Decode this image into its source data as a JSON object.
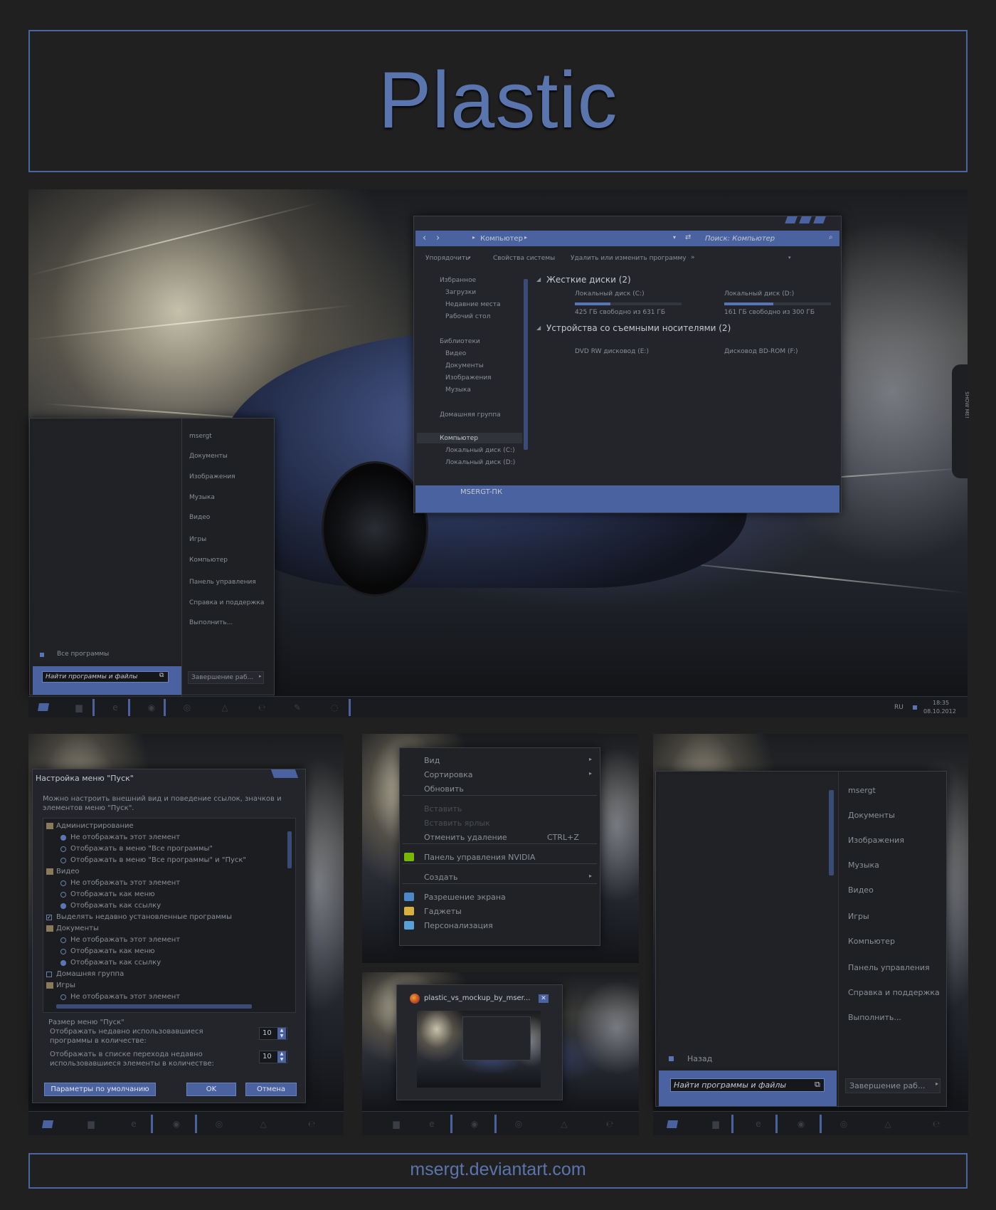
{
  "header": {
    "title": "Plastic"
  },
  "footer": {
    "url": "msergt.deviantart.com"
  },
  "explorer": {
    "breadcrumb": "Компьютер",
    "search_placeholder": "Поиск: Компьютер",
    "toolbar": [
      "Упорядочить",
      "Свойства системы",
      "Удалить или изменить программу",
      "»"
    ],
    "nav": {
      "favorites": "Избранное",
      "fav_items": [
        "Загрузки",
        "Недавние места",
        "Рабочий стол"
      ],
      "libraries": "Библиотеки",
      "lib_items": [
        "Видео",
        "Документы",
        "Изображения",
        "Музыка"
      ],
      "homegroup": "Домашняя группа",
      "computer": "Компьютер",
      "comp_items": [
        "Локальный диск (C:)",
        "Локальный диск (D:)"
      ]
    },
    "hdd_group": "Жесткие диски (2)",
    "drives": [
      {
        "name": "Локальный диск (C:)",
        "free": "425 ГБ свободно из 631 ГБ",
        "used_fraction": 0.33
      },
      {
        "name": "Локальный диск (D:)",
        "free": "161 ГБ свободно из 300 ГБ",
        "used_fraction": 0.46
      }
    ],
    "removable_group": "Устройства со съемными носителями (2)",
    "removable": [
      "DVD RW дисковод (E:)",
      "Дисковод BD-ROM (F:)"
    ],
    "status_name": "MSERGT-ПК"
  },
  "side_tab": "SHOW ME!",
  "start_menu": {
    "items": [
      "msergt",
      "Документы",
      "Изображения",
      "Музыка",
      "Видео",
      "Игры",
      "Компьютер",
      "Панель управления",
      "Справка и поддержка",
      "Выполнить..."
    ],
    "all_programs": "Все программы",
    "search_placeholder": "Найти программы и файлы",
    "shutdown": "Завершение раб..."
  },
  "tray": {
    "lang": "RU",
    "time": "18:35",
    "date": "08.10.2012"
  },
  "customize_dialog": {
    "title": "Настройка меню \"Пуск\"",
    "description_1": "Можно настроить внешний вид и поведение ссылок, значков и",
    "description_2": "элементов меню \"Пуск\".",
    "tree": [
      {
        "type": "folder",
        "label": "Администрирование"
      },
      {
        "type": "radio",
        "on": true,
        "label": "Не отображать этот элемент"
      },
      {
        "type": "radio",
        "on": false,
        "label": "Отображать в меню \"Все программы\""
      },
      {
        "type": "radio",
        "on": false,
        "label": "Отображать в меню \"Все программы\" и \"Пуск\""
      },
      {
        "type": "folder",
        "label": "Видео"
      },
      {
        "type": "radio",
        "on": false,
        "label": "Не отображать этот элемент"
      },
      {
        "type": "radio",
        "on": false,
        "label": "Отображать как меню"
      },
      {
        "type": "radio",
        "on": true,
        "label": "Отображать как ссылку"
      },
      {
        "type": "check",
        "on": true,
        "label": "Выделять недавно установленные программы"
      },
      {
        "type": "folder",
        "label": "Документы"
      },
      {
        "type": "radio",
        "on": false,
        "label": "Не отображать этот элемент"
      },
      {
        "type": "radio",
        "on": false,
        "label": "Отображать как меню"
      },
      {
        "type": "radio",
        "on": true,
        "label": "Отображать как ссылку"
      },
      {
        "type": "check",
        "on": false,
        "label": "Домашняя группа"
      },
      {
        "type": "folder",
        "label": "Игры"
      },
      {
        "type": "radio",
        "on": false,
        "label": "Не отображать этот элемент"
      }
    ],
    "size_label": "Размер меню \"Пуск\"",
    "recent_programs_1": "Отображать недавно использовавшиеся",
    "recent_programs_2": "программы в количестве:",
    "recent_programs_value": "10",
    "jump_list_1": "Отображать в списке перехода недавно",
    "jump_list_2": "использовавшиеся элементы в количестве:",
    "jump_list_value": "10",
    "defaults_button": "Параметры по умолчанию",
    "ok_button": "OK",
    "cancel_button": "Отмена"
  },
  "context_menu": {
    "items": [
      {
        "label": "Вид",
        "arrow": true
      },
      {
        "label": "Сортировка",
        "arrow": true
      },
      {
        "label": "Обновить"
      },
      {
        "label": "Вставить",
        "disabled": true
      },
      {
        "label": "Вставить ярлык",
        "disabled": true
      },
      {
        "label": "Отменить удаление",
        "shortcut": "CTRL+Z"
      },
      {
        "label": "Панель управления NVIDIA",
        "icon": "nvidia-icon"
      },
      {
        "label": "Создать",
        "arrow": true
      },
      {
        "label": "Разрешение экрана",
        "icon": "display-icon"
      },
      {
        "label": "Гаджеты",
        "icon": "gadgets-icon"
      },
      {
        "label": "Персонализация",
        "icon": "personalize-icon"
      }
    ]
  },
  "thumbnail": {
    "title": "plastic_vs_mockup_by_mser..."
  },
  "start_menu_large": {
    "items": [
      "msergt",
      "Документы",
      "Изображения",
      "Музыка",
      "Видео",
      "Игры",
      "Компьютер",
      "Панель управления",
      "Справка и поддержка",
      "Выполнить..."
    ],
    "back": "Назад",
    "search_placeholder": "Найти программы и файлы",
    "shutdown": "Завершение раб..."
  },
  "colors": {
    "accent": "#4a63a0",
    "frame": "#4a66a0",
    "background": "#202020",
    "panel": "#23252a"
  }
}
